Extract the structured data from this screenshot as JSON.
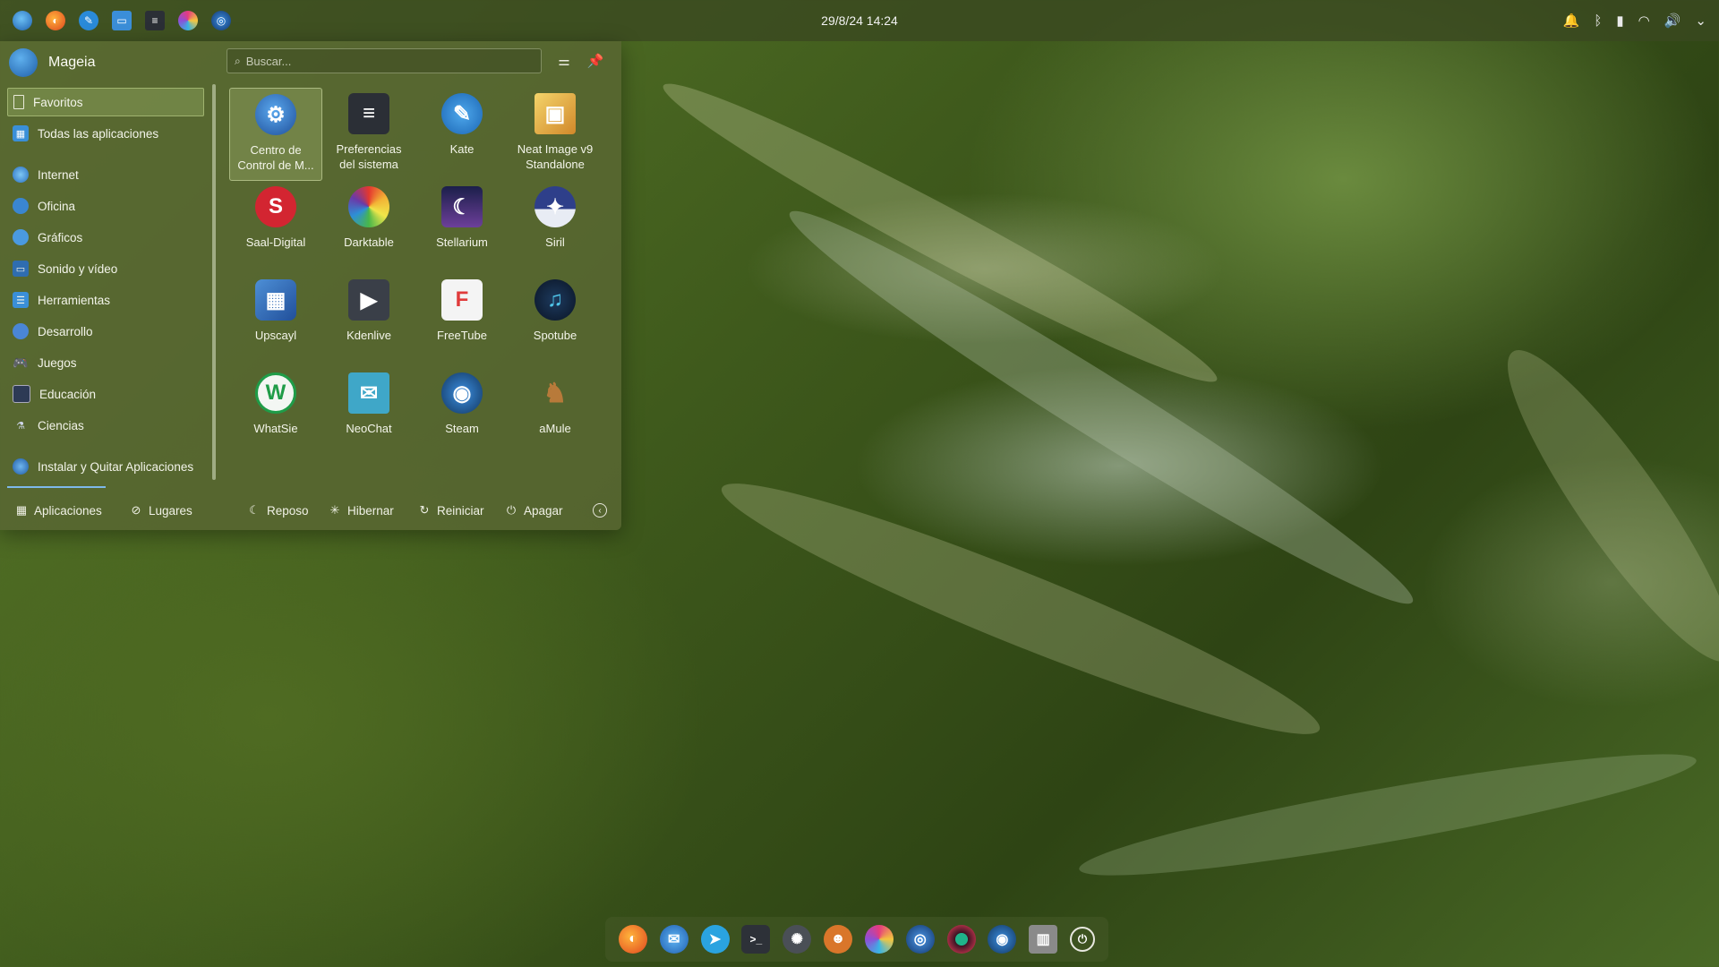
{
  "panel": {
    "clock": "29/8/24 14:24",
    "launchers": [
      "mageia-menu-icon",
      "firefox-icon",
      "kde-icon",
      "files-icon",
      "settings-icon",
      "colorful-app-icon",
      "steam-like-icon"
    ],
    "tray": [
      "notifications-icon",
      "bluetooth-icon",
      "usb-icon",
      "wifi-icon",
      "volume-icon",
      "expand-icon"
    ]
  },
  "menu": {
    "user": "Mageia",
    "search_placeholder": "Buscar...",
    "categories": [
      {
        "label": "Favoritos",
        "icon": "bookmark-icon",
        "selected": true
      },
      {
        "label": "Todas las aplicaciones",
        "icon": "grid-icon"
      },
      {
        "label": "Internet",
        "icon": "globe-icon"
      },
      {
        "label": "Oficina",
        "icon": "office-icon"
      },
      {
        "label": "Gráficos",
        "icon": "graphics-icon"
      },
      {
        "label": "Sonido y vídeo",
        "icon": "multimedia-icon"
      },
      {
        "label": "Herramientas",
        "icon": "tools-icon"
      },
      {
        "label": "Desarrollo",
        "icon": "development-icon"
      },
      {
        "label": "Juegos",
        "icon": "gamepad-icon"
      },
      {
        "label": "Educación",
        "icon": "education-icon"
      },
      {
        "label": "Ciencias",
        "icon": "science-icon"
      },
      {
        "label": "Instalar y Quitar Aplicaciones",
        "icon": "install-icon"
      }
    ],
    "apps": [
      {
        "label": "Centro de\nControl de M...",
        "icon": "control-center-icon",
        "color": "#2f6fc4",
        "glyph": "⚙",
        "selected": true
      },
      {
        "label": "Preferencias\ndel sistema",
        "icon": "system-settings-icon",
        "color": "#2b2f36",
        "glyph": "≡"
      },
      {
        "label": "Kate",
        "icon": "kate-icon",
        "color": "#2a8ad8",
        "glyph": "✎"
      },
      {
        "label": "Neat Image v9\nStandalone",
        "icon": "neat-image-icon",
        "color": "#e6b43a",
        "glyph": "▣"
      },
      {
        "label": "Saal-Digital",
        "icon": "saal-digital-icon",
        "color": "#d32531",
        "glyph": "S"
      },
      {
        "label": "Darktable",
        "icon": "darktable-icon",
        "color": "#6a2a6a",
        "glyph": "✺"
      },
      {
        "label": "Stellarium",
        "icon": "stellarium-icon",
        "color": "#2b2d63",
        "glyph": "☾"
      },
      {
        "label": "Siril",
        "icon": "siril-icon",
        "color": "#3b4b8a",
        "glyph": "✦"
      },
      {
        "label": "Upscayl",
        "icon": "upscayl-icon",
        "color": "#3a78c2",
        "glyph": "▦"
      },
      {
        "label": "Kdenlive",
        "icon": "kdenlive-icon",
        "color": "#3a3f48",
        "glyph": "▶"
      },
      {
        "label": "FreeTube",
        "icon": "freetube-icon",
        "color": "#f1f1f1",
        "glyph": "F"
      },
      {
        "label": "Spotube",
        "icon": "spotube-icon",
        "color": "#10203a",
        "glyph": "♫"
      },
      {
        "label": "WhatSie",
        "icon": "whatsie-icon",
        "color": "#1f9c48",
        "glyph": "W"
      },
      {
        "label": "NeoChat",
        "icon": "neochat-icon",
        "color": "#3fa7c8",
        "glyph": "✉"
      },
      {
        "label": "Steam",
        "icon": "steam-icon",
        "color": "#1b6ea8",
        "glyph": "◉"
      },
      {
        "label": "aMule",
        "icon": "amule-icon",
        "color": "#8a5a2a",
        "glyph": "♞"
      }
    ],
    "footer": {
      "aplicaciones": "Aplicaciones",
      "lugares": "Lugares",
      "reposo": "Reposo",
      "hibernar": "Hibernar",
      "reiniciar": "Reiniciar",
      "apagar": "Apagar"
    }
  },
  "dock": [
    {
      "name": "firefox-icon",
      "color": "#e66a1f",
      "glyph": "◐"
    },
    {
      "name": "thunderbird-icon",
      "color": "#2b7bd6",
      "glyph": "✉"
    },
    {
      "name": "telegram-icon",
      "color": "#2aa3e0",
      "glyph": "➤"
    },
    {
      "name": "terminal-icon",
      "color": "#2d3138",
      "glyph": ">_"
    },
    {
      "name": "aperture-icon",
      "color": "#4a4f56",
      "glyph": "✺"
    },
    {
      "name": "game-icon",
      "color": "#d9762a",
      "glyph": "☻"
    },
    {
      "name": "colorful-app-icon",
      "color": "#c2409a",
      "glyph": "◑"
    },
    {
      "name": "world-app-icon",
      "color": "#1f5fb0",
      "glyph": "◎"
    },
    {
      "name": "record-icon",
      "color": "#b23048",
      "glyph": "●"
    },
    {
      "name": "steam-icon",
      "color": "#1b6ea8",
      "glyph": "◉"
    },
    {
      "name": "archive-icon",
      "color": "#7a7a7a",
      "glyph": "▥"
    },
    {
      "name": "power-icon",
      "color": "rgba(0,0,0,0)",
      "glyph": "⏻"
    }
  ]
}
